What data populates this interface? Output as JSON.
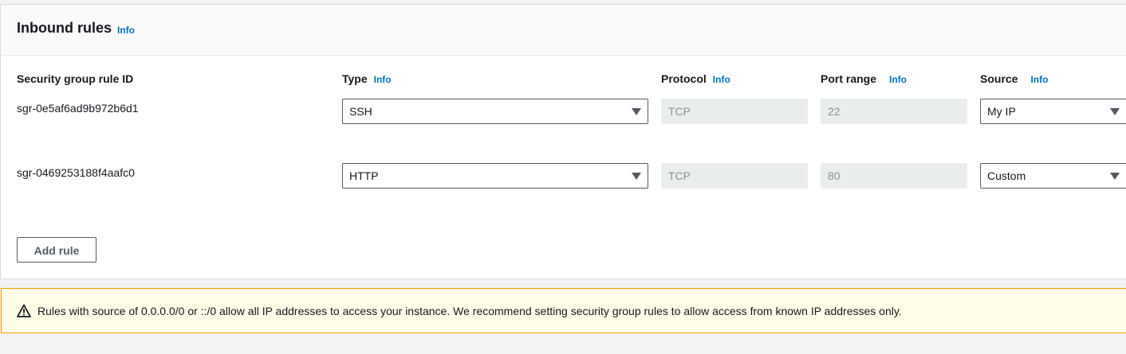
{
  "section": {
    "title": "Inbound rules",
    "info_label": "Info"
  },
  "columns": {
    "rule_id": "Security group rule ID",
    "type": "Type",
    "protocol": "Protocol",
    "port_range": "Port range",
    "source": "Source",
    "info_label": "Info"
  },
  "rules": [
    {
      "id": "sgr-0e5af6ad9b972b6d1",
      "type": "SSH",
      "protocol": "TCP",
      "port_range": "22",
      "source": "My IP"
    },
    {
      "id": "sgr-0469253188f4aafc0",
      "type": "HTTP",
      "protocol": "TCP",
      "port_range": "80",
      "source": "Custom"
    }
  ],
  "actions": {
    "add_rule_label": "Add rule"
  },
  "warning": {
    "icon": "warning-triangle-icon",
    "text": "Rules with source of 0.0.0.0/0 or ::/0 allow all IP addresses to access your instance. We recommend setting security group rules to allow access from known IP addresses only."
  },
  "colors": {
    "info_link": "#0073bb",
    "warning_border": "#ff9900",
    "warning_bg": "#fffce7"
  }
}
